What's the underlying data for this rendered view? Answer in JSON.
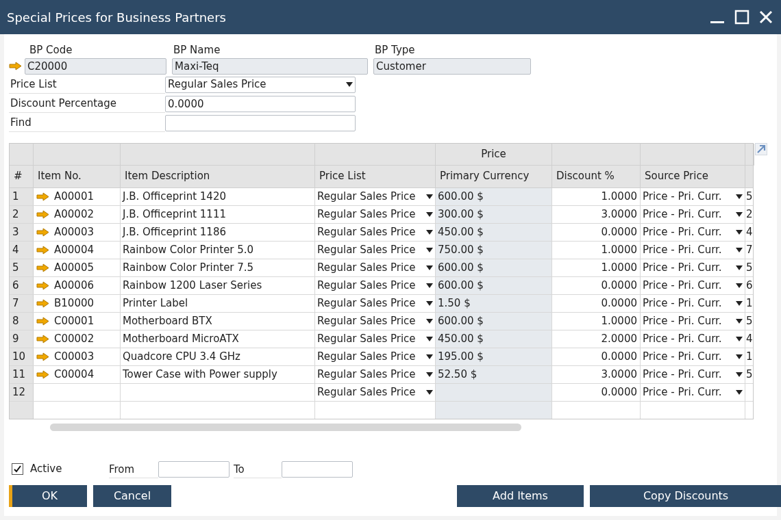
{
  "window": {
    "title": "Special Prices for Business Partners"
  },
  "header": {
    "bp_code": {
      "label": "BP Code",
      "value": "C20000"
    },
    "bp_name": {
      "label": "BP Name",
      "value": "Maxi-Teq"
    },
    "bp_type": {
      "label": "BP Type",
      "value": "Customer"
    },
    "price_list": {
      "label": "Price List",
      "value": "Regular Sales Price"
    },
    "discount": {
      "label": "Discount Percentage",
      "value": "0.0000"
    },
    "find": {
      "label": "Find"
    }
  },
  "table": {
    "group_header": "Price",
    "columns": [
      "#",
      "Item No.",
      "Item Description",
      "Price List",
      "Primary Currency",
      "Discount %",
      "Source Price"
    ],
    "rows": [
      {
        "num": "1",
        "item": "A00001",
        "description": "J.B. Officeprint 1420",
        "price_list": "Regular Sales Price",
        "price": "600.00 $",
        "discount": "1.0000",
        "source_price": "Price - Pri. Curr.",
        "column_8": "5"
      },
      {
        "num": "2",
        "item": "A00002",
        "description": "J.B. Officeprint 1111",
        "price_list": "Regular Sales Price",
        "price": "300.00 $",
        "discount": "3.0000",
        "source_price": "Price - Pri. Curr.",
        "column_8": "2"
      },
      {
        "num": "3",
        "item": "A00003",
        "description": "J.B. Officeprint 1186",
        "price_list": "Regular Sales Price",
        "price": "450.00 $",
        "discount": "0.0000",
        "source_price": "Price - Pri. Curr.",
        "column_8": "4"
      },
      {
        "num": "4",
        "item": "A00004",
        "description": "Rainbow Color Printer 5.0",
        "price_list": "Regular Sales Price",
        "price": "750.00 $",
        "discount": "1.0000",
        "source_price": "Price - Pri. Curr.",
        "column_8": "7"
      },
      {
        "num": "5",
        "item": "A00005",
        "description": "Rainbow Color Printer 7.5",
        "price_list": "Regular Sales Price",
        "price": "600.00 $",
        "discount": "1.0000",
        "source_price": "Price - Pri. Curr.",
        "column_8": "5"
      },
      {
        "num": "6",
        "item": "A00006",
        "description": "Rainbow 1200 Laser Series",
        "price_list": "Regular Sales Price",
        "price": "600.00 $",
        "discount": "0.0000",
        "source_price": "Price - Pri. Curr.",
        "column_8": "6"
      },
      {
        "num": "7",
        "item": "B10000",
        "description": "Printer Label",
        "price_list": "Regular Sales Price",
        "price": "1.50 $",
        "discount": "0.0000",
        "source_price": "Price - Pri. Curr.",
        "column_8": "1"
      },
      {
        "num": "8",
        "item": "C00001",
        "description": "Motherboard BTX",
        "price_list": "Regular Sales Price",
        "price": "600.00 $",
        "discount": "1.0000",
        "source_price": "Price - Pri. Curr.",
        "column_8": "5"
      },
      {
        "num": "9",
        "item": "C00002",
        "description": "Motherboard MicroATX",
        "price_list": "Regular Sales Price",
        "price": "450.00 $",
        "discount": "2.0000",
        "source_price": "Price - Pri. Curr.",
        "column_8": "4"
      },
      {
        "num": "10",
        "item": "C00003",
        "description": "Quadcore CPU 3.4 GHz",
        "price_list": "Regular Sales Price",
        "price": "195.00 $",
        "discount": "0.0000",
        "source_price": "Price - Pri. Curr.",
        "column_8": "1"
      },
      {
        "num": "11",
        "item": "C00004",
        "description": "Tower Case with Power supply",
        "price_list": "Regular Sales Price",
        "price": "52.50 $",
        "discount": "3.0000",
        "source_price": "Price - Pri. Curr.",
        "column_8": "5"
      },
      {
        "num": "12",
        "price_list": "Regular Sales Price",
        "discount": "0.0000",
        "source_price": "Price - Pri. Curr."
      }
    ]
  },
  "footer": {
    "active": {
      "label": "Active",
      "checked": true
    },
    "from": {
      "label": "From"
    },
    "to": {
      "label": "To"
    }
  },
  "buttons": [
    {
      "label": "OK",
      "kind": "default"
    },
    {
      "label": "Cancel",
      "kind": "normal"
    },
    {
      "label": "Add Items",
      "kind": "normal"
    },
    {
      "label": "Copy Discounts",
      "kind": "normal"
    }
  ]
}
